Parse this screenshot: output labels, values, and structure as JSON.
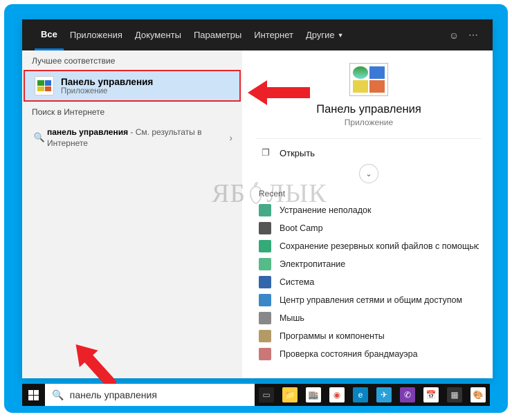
{
  "tabs": {
    "items": [
      "Все",
      "Приложения",
      "Документы",
      "Параметры",
      "Интернет",
      "Другие"
    ],
    "active_index": 0
  },
  "left": {
    "best_header": "Лучшее соответствие",
    "best": {
      "title": "Панель управления",
      "subtitle": "Приложение"
    },
    "web_header": "Поиск в Интернете",
    "web_result": {
      "query": "панель управления",
      "suffix": " - См. результаты в Интернете"
    }
  },
  "right": {
    "title": "Панель управления",
    "subtitle": "Приложение",
    "open_label": "Открыть",
    "recent_header": "Recent",
    "recent": [
      {
        "label": "Устранение неполадок",
        "color": "#4a8"
      },
      {
        "label": "Boot Camp",
        "color": "#555"
      },
      {
        "label": "Сохранение резервных копий файлов с помощью ист...",
        "color": "#3a7"
      },
      {
        "label": "Электропитание",
        "color": "#5b8"
      },
      {
        "label": "Система",
        "color": "#36a"
      },
      {
        "label": "Центр управления сетями и общим доступом",
        "color": "#3a88c8"
      },
      {
        "label": "Мышь",
        "color": "#888"
      },
      {
        "label": "Программы и компоненты",
        "color": "#b49b66"
      },
      {
        "label": "Проверка состояния брандмауэра",
        "color": "#c77"
      }
    ]
  },
  "taskbar": {
    "search_value": "панель управления",
    "icons": [
      {
        "name": "task-view",
        "bg": "#222",
        "fg": "#bbb",
        "glyph": "▭"
      },
      {
        "name": "file-explorer",
        "bg": "#ffcf3f",
        "fg": "#8a6",
        "glyph": "📁"
      },
      {
        "name": "store",
        "bg": "#fff",
        "fg": "#333",
        "glyph": "🏬"
      },
      {
        "name": "chrome",
        "bg": "#fff",
        "fg": "#dd4b39",
        "glyph": "◉"
      },
      {
        "name": "edge",
        "bg": "#0a84c1",
        "fg": "#fff",
        "glyph": "e"
      },
      {
        "name": "telegram",
        "bg": "#29a0da",
        "fg": "#fff",
        "glyph": "✈"
      },
      {
        "name": "viber",
        "bg": "#7d3daf",
        "fg": "#fff",
        "glyph": "✆"
      },
      {
        "name": "calendar",
        "bg": "#fff",
        "fg": "#c33",
        "glyph": "📅"
      },
      {
        "name": "calculator",
        "bg": "#333",
        "fg": "#ddd",
        "glyph": "▦"
      },
      {
        "name": "paint",
        "bg": "#fff",
        "fg": "#555",
        "glyph": "🎨"
      }
    ]
  },
  "watermark": "ЯБ ЛЫК"
}
